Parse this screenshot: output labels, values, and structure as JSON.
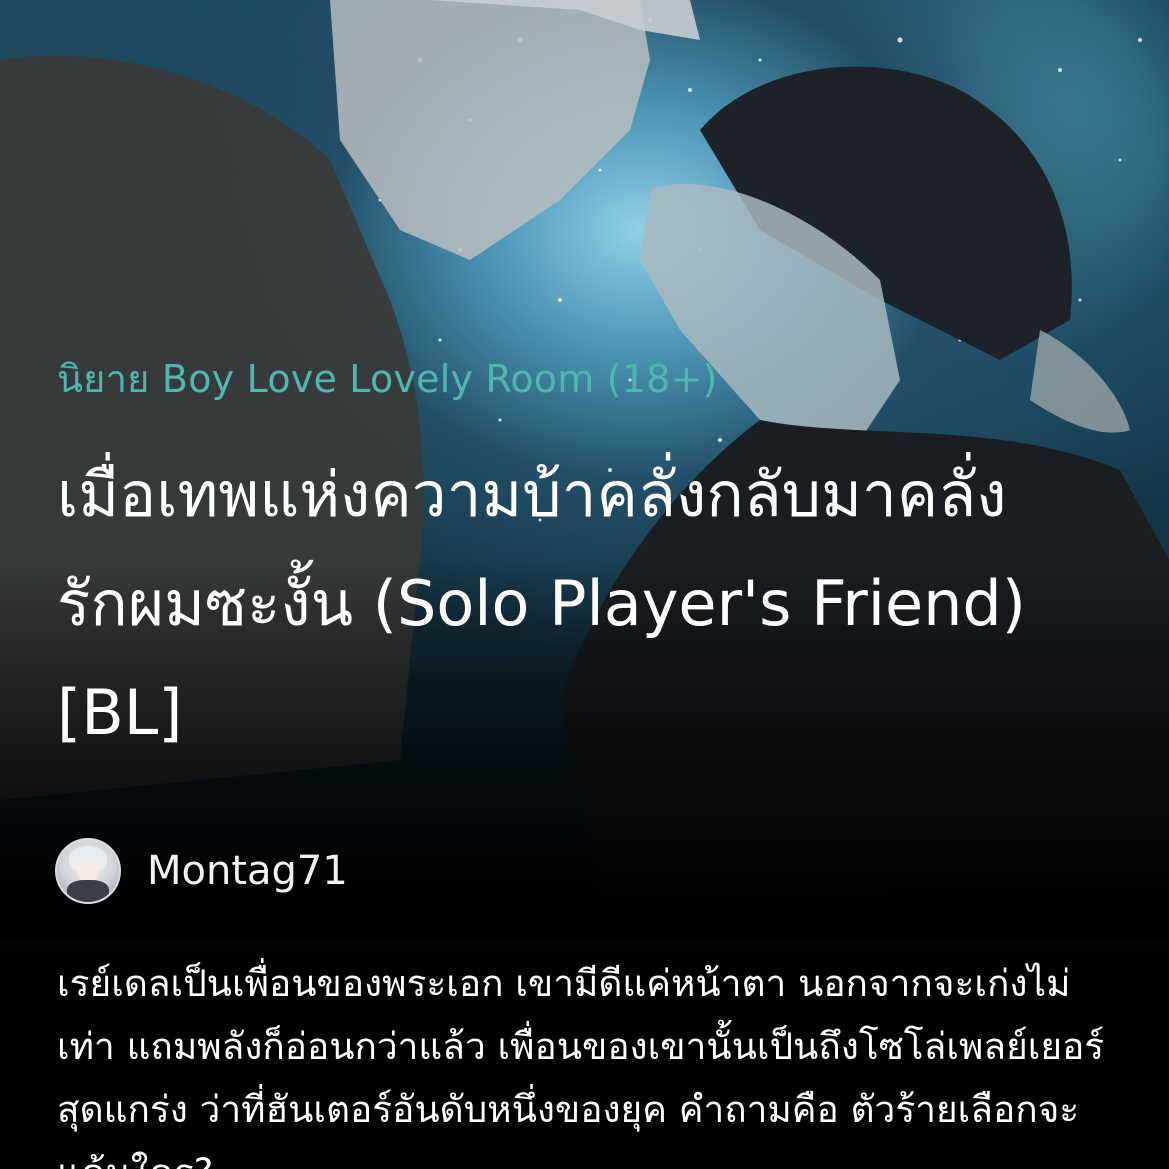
{
  "novel": {
    "category": "นิยาย Boy Love Lovely Room (18+)",
    "title": "เมื่อเทพแห่งความบ้าคลั่งกลับมาคลั่งรักผมซะงั้น (Solo Player's Friend) [BL]",
    "author": {
      "name": "Montag71",
      "avatar_icon": "avatar-icon"
    },
    "description": "เรย์เดลเป็นเพื่อนของพระเอก เขามีดีแค่หน้าตา นอกจากจะเก่งไม่เท่า แถมพลังก็อ่อนกว่าแล้ว เพื่อนของเขานั้นเป็นถึงโซโล่เพลย์เยอร์สุดแกร่ง ว่าที่ฮันเตอร์อันดับหนึ่งของยุค คำถามคือ ตัวร้ายเลือกจะแค้นใคร?"
  },
  "colors": {
    "category": "#4fb7ad",
    "title": "#ffffff",
    "background": "#000000"
  }
}
